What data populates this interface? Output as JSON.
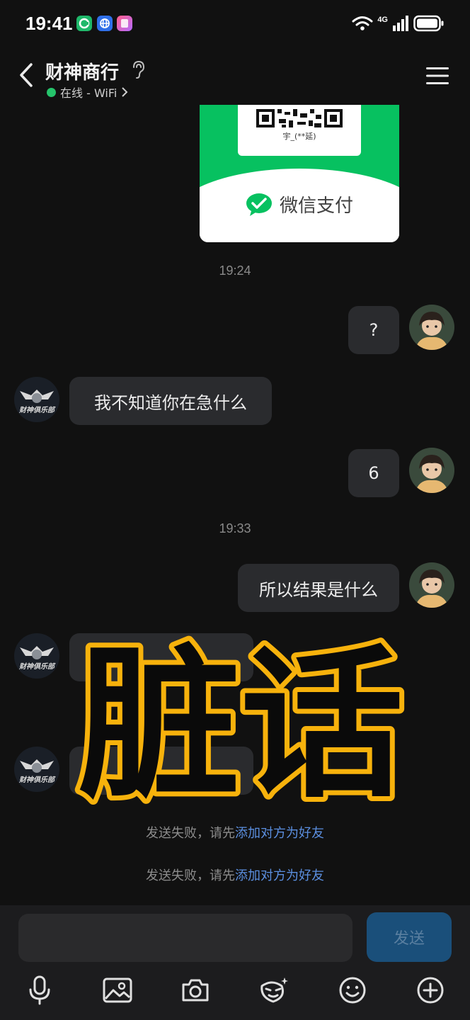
{
  "status_bar": {
    "time": "19:41",
    "network": "4G"
  },
  "header": {
    "title": "财神商行",
    "status": "在线 - WiFi",
    "status_color": "#25c46b"
  },
  "payment_card": {
    "qr_name": "宇_(**延)",
    "brand": "微信支付",
    "brand_color": "#07c160"
  },
  "messages": [
    {
      "type": "timestamp",
      "text": "19:24"
    },
    {
      "type": "sent",
      "text": "?"
    },
    {
      "type": "received",
      "text": "我不知道你在急什么",
      "sender_badge": "财神俱乐部"
    },
    {
      "type": "sent",
      "text": "6"
    },
    {
      "type": "timestamp",
      "text": "19:33"
    },
    {
      "type": "sent",
      "text": "所以结果是什么"
    }
  ],
  "overlay_caption": "脏话",
  "notices": [
    {
      "prefix": "发送失败，请先",
      "link": "添加对方为好友"
    },
    {
      "prefix": "发送失败，请先",
      "link": "添加对方为好友"
    }
  ],
  "composer": {
    "input_value": "",
    "send_label": "发送"
  },
  "toolbar_icons": [
    "microphone-icon",
    "image-icon",
    "camera-icon",
    "sticker-icon",
    "emoji-icon",
    "plus-icon"
  ]
}
